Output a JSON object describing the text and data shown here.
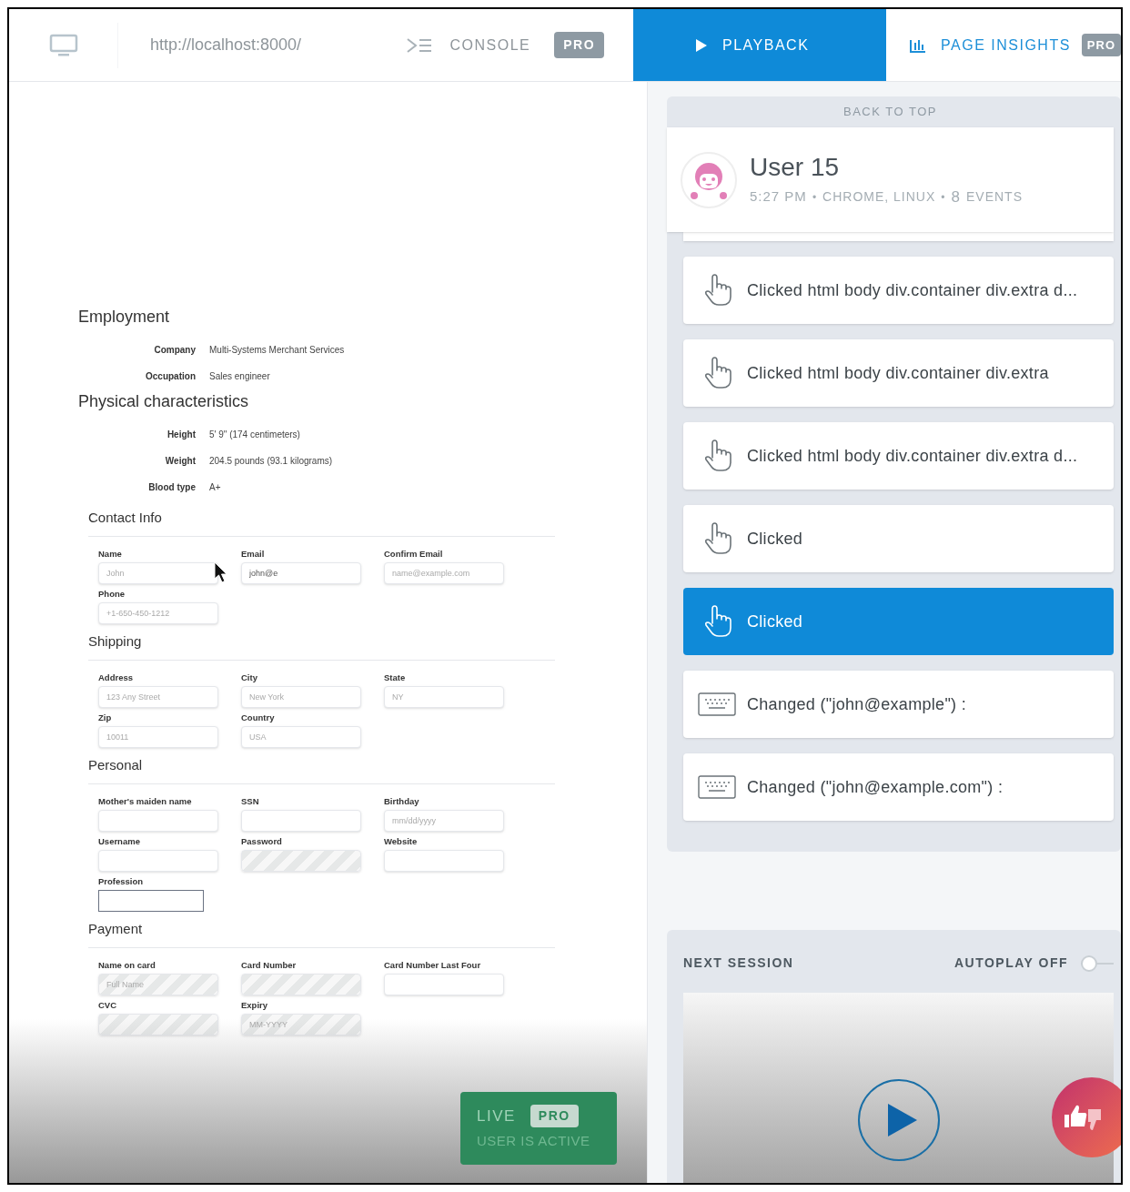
{
  "toolbar": {
    "url": "http://localhost:8000/",
    "console": {
      "label": "CONSOLE",
      "badge": "PRO"
    }
  },
  "tabs": [
    {
      "kind": "playback",
      "label": "PLAYBACK",
      "selected": true
    },
    {
      "kind": "insights",
      "label": "PAGE INSIGHTS",
      "badge": "PRO",
      "selected": false
    }
  ],
  "details": [
    {
      "heading": "Employment",
      "rows": [
        {
          "label": "Company",
          "value": "Multi-Systems Merchant Services"
        },
        {
          "label": "Occupation",
          "value": "Sales engineer"
        }
      ]
    },
    {
      "heading": "Physical characteristics",
      "rows": [
        {
          "label": "Height",
          "value": "5' 9\" (174 centimeters)"
        },
        {
          "label": "Weight",
          "value": "204.5 pounds (93.1 kilograms)"
        },
        {
          "label": "Blood type",
          "value": "A+"
        }
      ]
    }
  ],
  "form_sections": [
    {
      "heading": "Contact Info",
      "rows": [
        [
          {
            "label": "Name",
            "placeholder": "John",
            "masked": false
          },
          {
            "label": "Email",
            "value": "john@e",
            "masked": false
          },
          {
            "label": "Confirm Email",
            "placeholder": "name@example.com",
            "masked": false
          }
        ],
        [
          {
            "label": "Phone",
            "placeholder": "+1-650-450-1212",
            "masked": false
          }
        ]
      ]
    },
    {
      "heading": "Shipping",
      "rows": [
        [
          {
            "label": "Address",
            "placeholder": "123 Any Street",
            "masked": false
          },
          {
            "label": "City",
            "placeholder": "New York",
            "masked": false
          },
          {
            "label": "State",
            "placeholder": "NY",
            "masked": false
          }
        ],
        [
          {
            "label": "Zip",
            "placeholder": "10011",
            "masked": false
          },
          {
            "label": "Country",
            "placeholder": "USA",
            "masked": false
          }
        ]
      ]
    },
    {
      "heading": "Personal",
      "rows": [
        [
          {
            "label": "Mother's maiden name",
            "masked": false
          },
          {
            "label": "SSN",
            "masked": false
          },
          {
            "label": "Birthday",
            "placeholder": "mm/dd/yyyy",
            "masked": false
          }
        ],
        [
          {
            "label": "Username",
            "masked": false
          },
          {
            "label": "Password",
            "masked": true
          },
          {
            "label": "Website",
            "masked": false
          }
        ],
        [
          {
            "label": "Profession",
            "masked": false,
            "plain": true
          }
        ]
      ]
    },
    {
      "heading": "Payment",
      "rows": [
        [
          {
            "label": "Name on card",
            "placeholder": "Full Name",
            "masked": true
          },
          {
            "label": "Card Number",
            "masked": true
          },
          {
            "label": "Card Number Last Four",
            "masked": false
          }
        ],
        [
          {
            "label": "CVC",
            "masked": true
          },
          {
            "label": "Expiry",
            "placeholder": "MM-YYYY",
            "masked": true
          }
        ]
      ]
    }
  ],
  "live": {
    "label": "LIVE",
    "badge": "PRO",
    "status": "USER IS ACTIVE"
  },
  "session": {
    "back_to_top": "BACK TO TOP",
    "user": "User 15",
    "time": "5:27 PM",
    "separator": "•",
    "meta": "CHROME, LINUX",
    "event_count": "8",
    "events_label": "EVENTS"
  },
  "events": [
    {
      "kind": "click",
      "text": "Clicked html body div.container div.extra d...",
      "selected": false
    },
    {
      "kind": "click",
      "text": "Clicked html body div.container div.extra",
      "selected": false
    },
    {
      "kind": "click",
      "text": "Clicked html body div.container div.extra d...",
      "selected": false
    },
    {
      "kind": "click",
      "text": "Clicked",
      "selected": false
    },
    {
      "kind": "click",
      "text": "Clicked",
      "selected": true
    },
    {
      "kind": "change",
      "text": "Changed (\"john@example\") :",
      "selected": false
    },
    {
      "kind": "change",
      "text": "Changed (\"john@example.com\") :",
      "selected": false
    }
  ],
  "next_session": {
    "title": "NEXT SESSION",
    "autoplay_label": "AUTOPLAY OFF",
    "autoplay_on": false
  }
}
